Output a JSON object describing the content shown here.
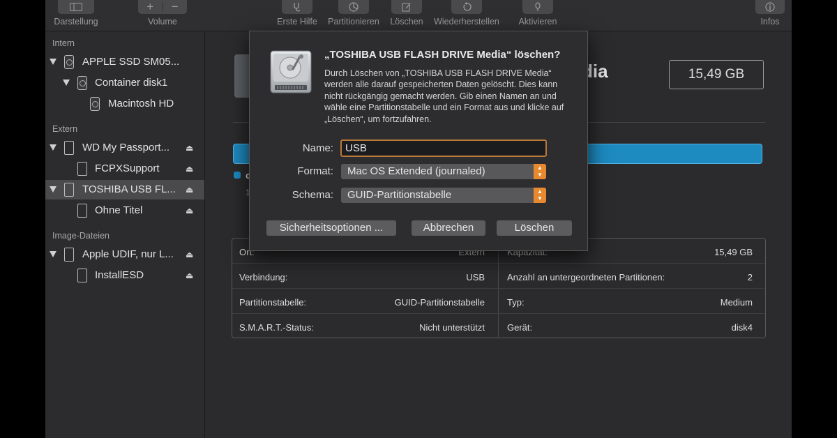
{
  "toolbar": {
    "darstellung": "Darstellung",
    "volume": "Volume",
    "volume_add": "+",
    "volume_remove": "−",
    "erste_hilfe": "Erste Hilfe",
    "partitionieren": "Partitionieren",
    "loeschen": "Löschen",
    "wiederherstellen": "Wiederherstellen",
    "aktivieren": "Aktivieren",
    "infos": "Infos"
  },
  "sidebar": {
    "sections": [
      "Intern",
      "Extern",
      "Image-Dateien"
    ],
    "items": [
      {
        "label": "APPLE SSD SM05..."
      },
      {
        "label": "Container disk1"
      },
      {
        "label": "Macintosh HD"
      },
      {
        "label": "WD My Passport..."
      },
      {
        "label": "FCPXSupport"
      },
      {
        "label": "TOSHIBA USB FL..."
      },
      {
        "label": "Ohne Titel"
      },
      {
        "label": "Apple UDIF, nur L..."
      },
      {
        "label": "InstallESD"
      }
    ],
    "eject_symbol": "⏏"
  },
  "main": {
    "title_fragment": "dia",
    "capacity": "15,49 GB",
    "legend_fragment": "c",
    "legend_sub_fragment": "1",
    "info": {
      "left": [
        {
          "label": "Ort:",
          "value": "Extern"
        },
        {
          "label": "Verbindung:",
          "value": "USB"
        },
        {
          "label": "Partitionstabelle:",
          "value": "GUID-Partitionstabelle"
        },
        {
          "label": "S.M.A.R.T.-Status:",
          "value": "Nicht unterstützt"
        }
      ],
      "right": [
        {
          "label": "Kapazität:",
          "value": "15,49 GB"
        },
        {
          "label": "Anzahl an untergeordneten Partitionen:",
          "value": "2"
        },
        {
          "label": "Typ:",
          "value": "Medium"
        },
        {
          "label": "Gerät:",
          "value": "disk4"
        }
      ]
    }
  },
  "dialog": {
    "title": "„TOSHIBA USB FLASH DRIVE Media“ löschen?",
    "message": "Durch Löschen von „TOSHIBA USB FLASH DRIVE Media“ werden alle darauf gespeicherten Daten gelöscht. Dies kann nicht rückgängig gemacht werden. Gib einen Namen an und wähle eine Partitionstabelle und ein Format aus und klicke auf „Löschen“, um fortzufahren.",
    "name_label": "Name:",
    "name_value": "USB",
    "format_label": "Format:",
    "format_value": "Mac OS Extended (journaled)",
    "schema_label": "Schema:",
    "schema_value": "GUID-Partitionstabelle",
    "btn_security": "Sicherheitsoptionen ...",
    "btn_cancel": "Abbrechen",
    "btn_erase": "Löschen"
  },
  "colors": {
    "accent": "#e88930",
    "usage_bar": "#1d8ac0",
    "focus_ring": "#b9793a"
  }
}
